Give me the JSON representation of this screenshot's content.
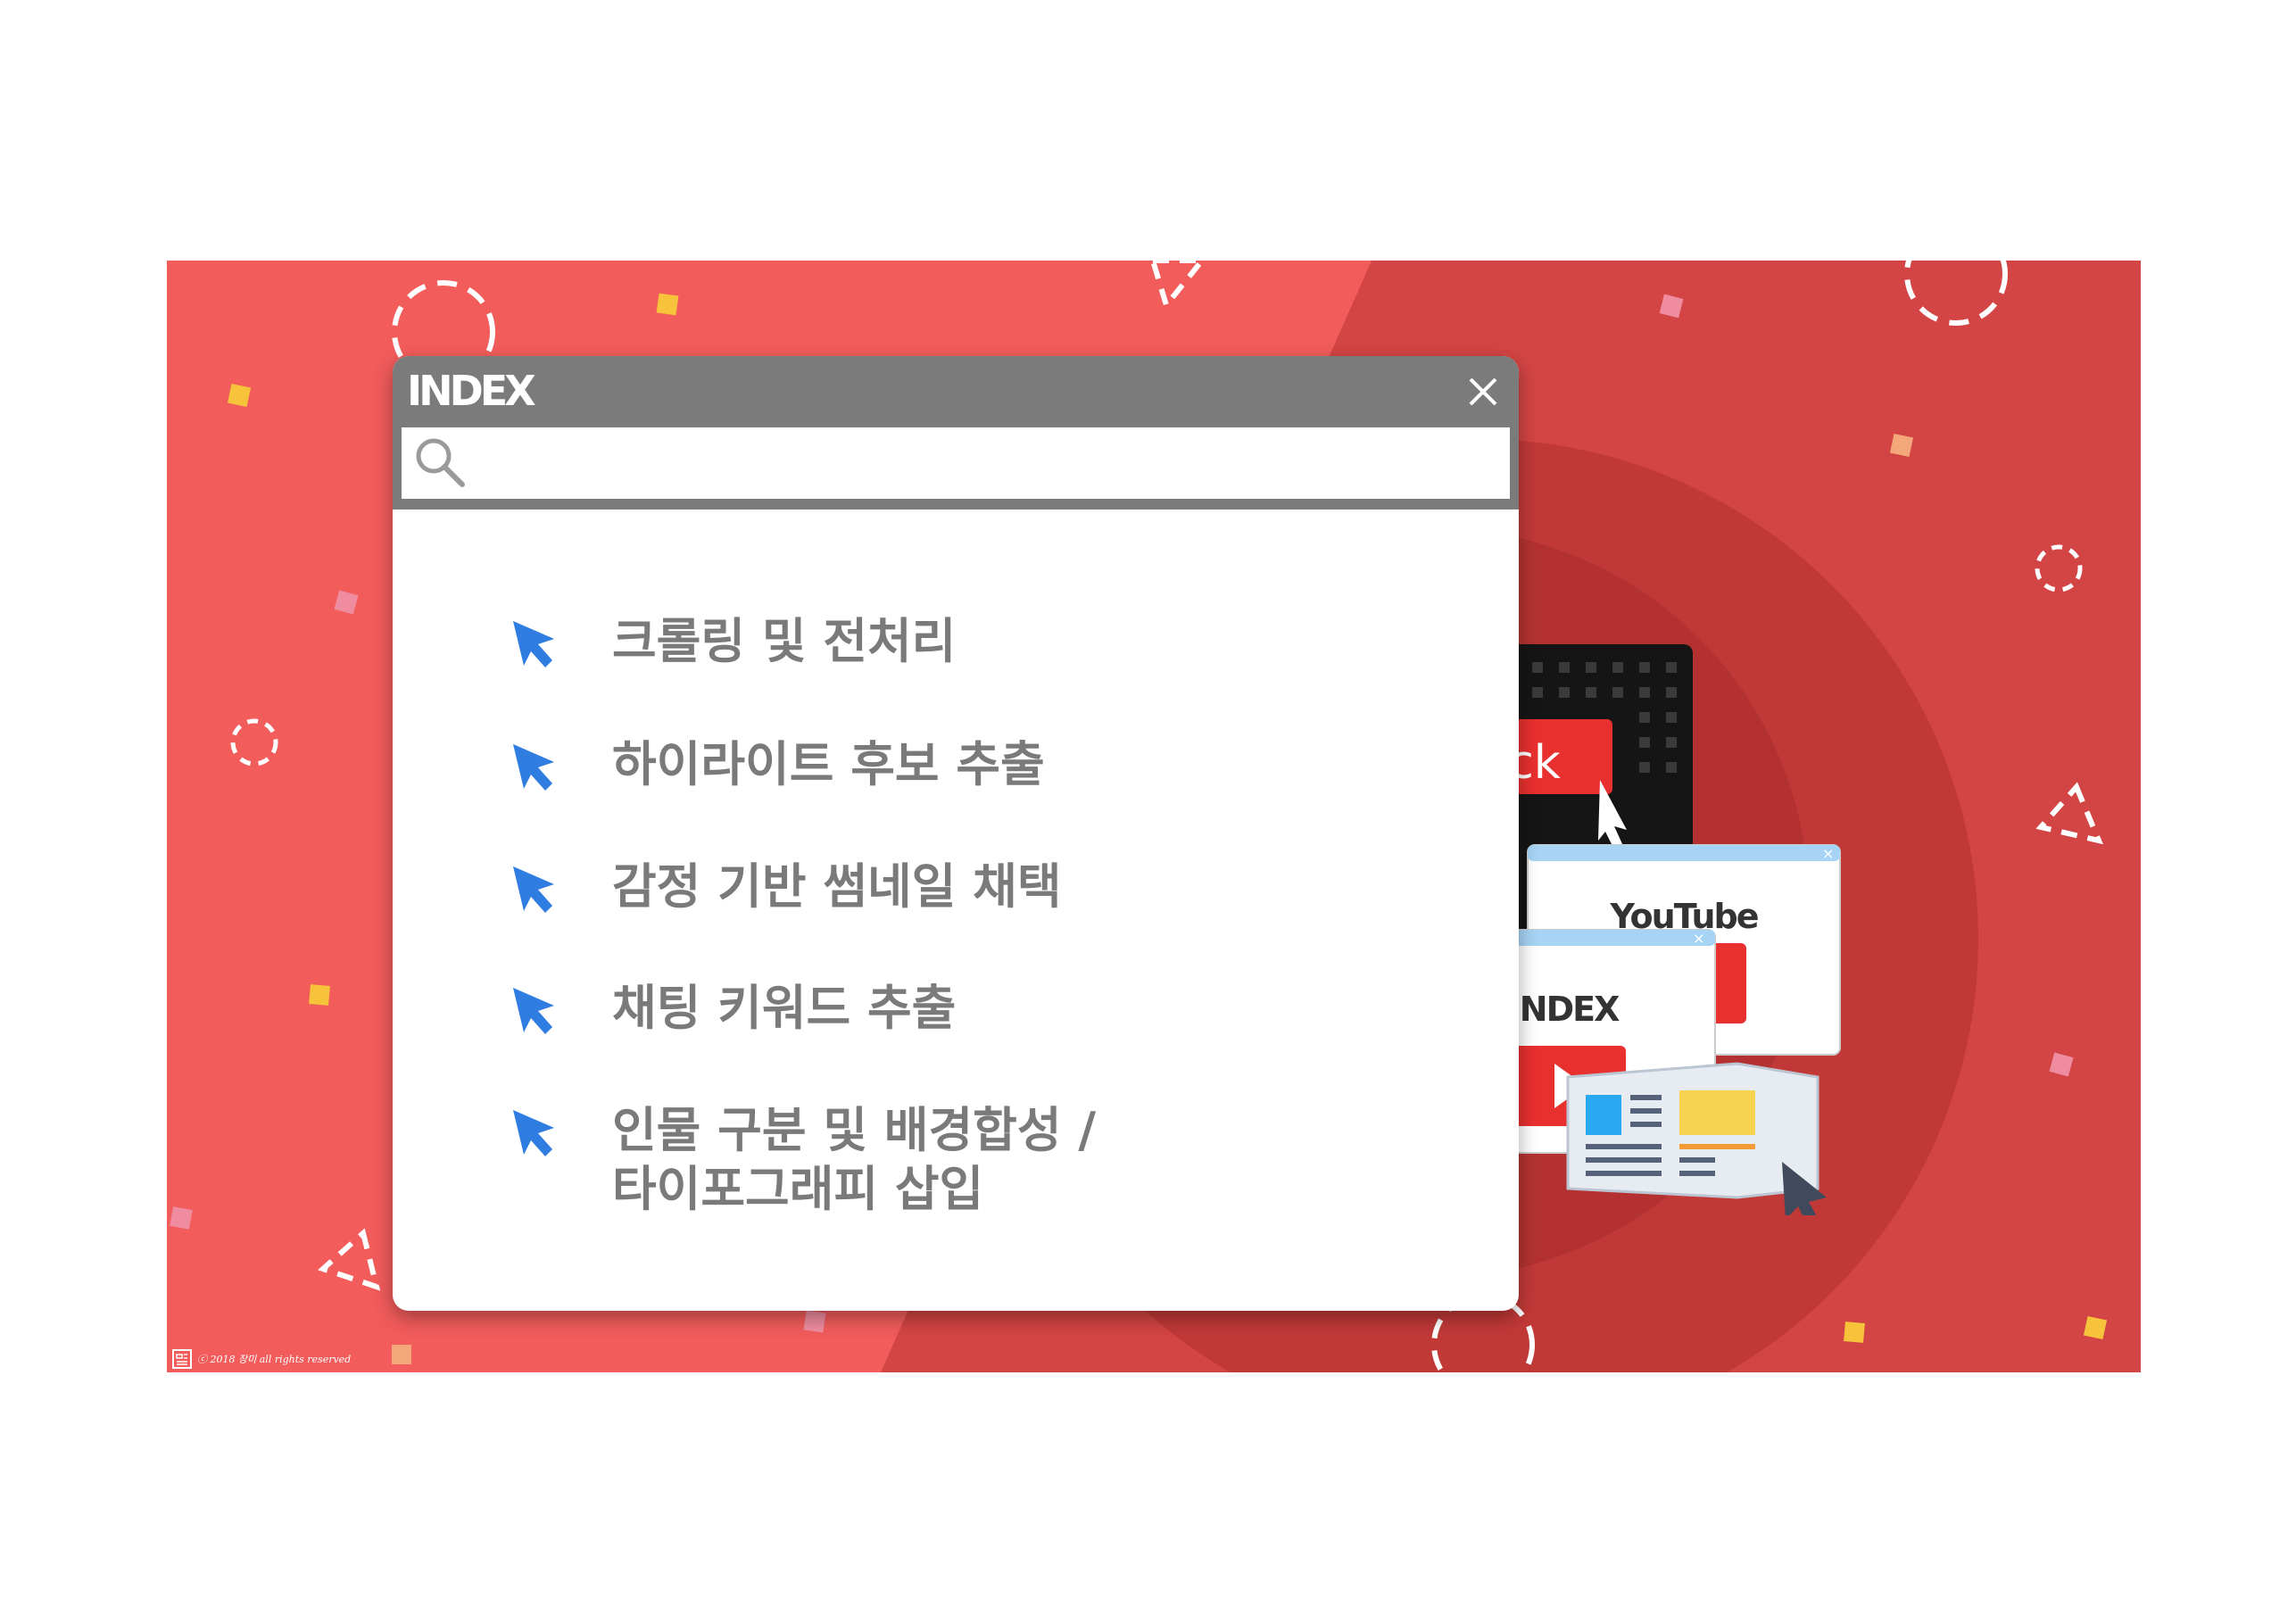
{
  "window": {
    "title": "INDEX",
    "search": {
      "value": "",
      "placeholder": ""
    }
  },
  "items": [
    {
      "label": "크롤링 및 전처리"
    },
    {
      "label": "하이라이트 후보 추출"
    },
    {
      "label": "감정 기반 썸네일 채택"
    },
    {
      "label": "채팅 키워드 추출"
    },
    {
      "label_line1": "인물 구분 및 배경합성 /",
      "label_line2": "타이포그래피 삽입"
    }
  ],
  "illustration": {
    "click_label": "Click",
    "youtube_label": "YouTube",
    "index_label": "INDEX"
  },
  "footer": {
    "copyright": "ⓒ 2018 장미 all rights reserved"
  },
  "colors": {
    "background_light": "#f25c5b",
    "background_dark": "#d34544",
    "accent_red": "#e8302f",
    "titlebar_gray": "#7b7b7b",
    "arrow_blue": "#2f7de1",
    "text_gray": "#7a7a7a"
  },
  "icons": [
    "close-icon",
    "search-icon",
    "cursor-arrow-icon",
    "play-icon",
    "newspaper-icon"
  ]
}
